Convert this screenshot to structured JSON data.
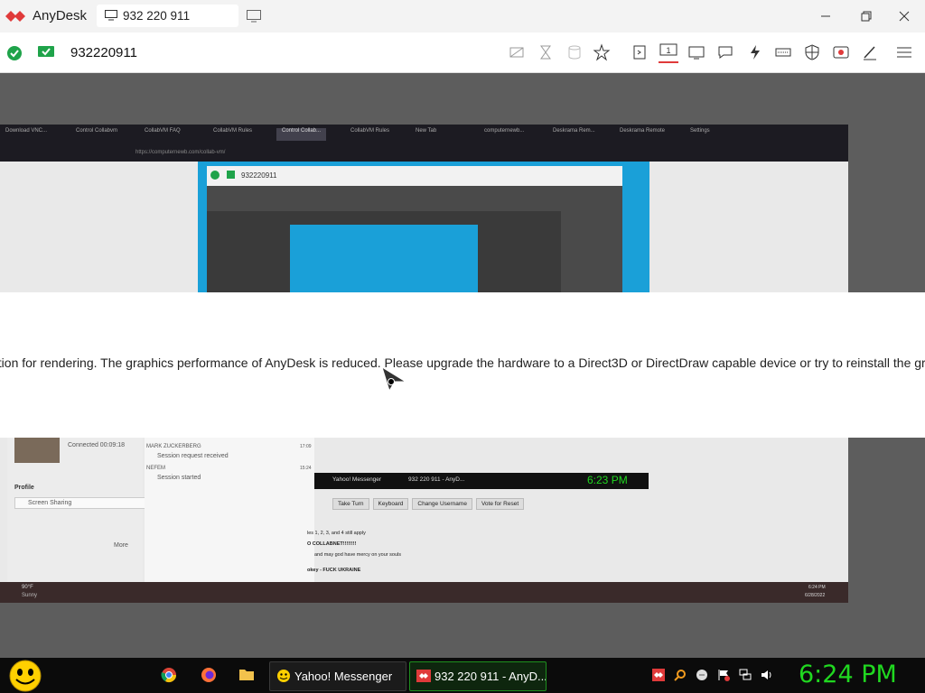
{
  "app": {
    "name": "AnyDesk",
    "tab_title": "932 220 911",
    "session_id": "932220911",
    "brand_color": "#e03a3a"
  },
  "toolbar_icons": [
    "connection-icon",
    "hourglass-icon",
    "database-icon",
    "star-icon",
    "file-transfer-icon",
    "monitor-select-icon",
    "display-icon",
    "chat-icon",
    "actions-icon",
    "keyboard-icon",
    "permissions-icon",
    "record-icon",
    "whiteboard-icon",
    "menu-icon"
  ],
  "remote": {
    "browser_tabs": [
      "Download VNC...",
      "Control Collabvm",
      "CollabVM FAQ",
      "CollabVM Rules",
      "Control Collab...",
      "CollabVM Rules",
      "New Tab",
      "computernewb...",
      "Deskrama Rem...",
      "Deskrama Remote",
      "Settings"
    ],
    "url": "https://computernewb.com/collab-vm/",
    "nested_session_id": "932220911",
    "connected_text": "Connected 00:09:18",
    "profile_label": "Profile",
    "profile_value": "Screen Sharing",
    "more_label": "More",
    "log": [
      {
        "name": "MARK ZUCKERBERG",
        "time": "17:09",
        "text": "Session request received"
      },
      {
        "name": "NEFEM",
        "time": "15:24",
        "text": "Session started"
      }
    ],
    "game_taskbar": {
      "item1": "Yahoo! Messenger",
      "item2": "932 220 911 - AnyD...",
      "clock": "6:23 PM"
    },
    "game_buttons": [
      "Take Turn",
      "Keyboard",
      "Change Username",
      "Vote for Reset"
    ],
    "chat_lines": [
      "les 1, 2, 3, and 4 still apply",
      "O COLLABNET!!!!!!!!",
      "and may god have mercy on your souls",
      "okey - FUCK UKRAINE"
    ],
    "weather": {
      "temp": "90°F",
      "cond": "Sunny"
    },
    "remote_clock": {
      "time": "6:24 PM",
      "date": "6/28/2022"
    }
  },
  "dialog": {
    "message": "ation for rendering. The graphics performance of AnyDesk is reduced. Please upgrade the hardware to a Direct3D or DirectDraw capable device or try to reinstall the graphics"
  },
  "taskbar": {
    "yahoo_label": "Yahoo! Messenger",
    "anydesk_label": "932 220 911 - AnyD...",
    "clock": "6:24 PM",
    "clock_color": "#20d820"
  }
}
